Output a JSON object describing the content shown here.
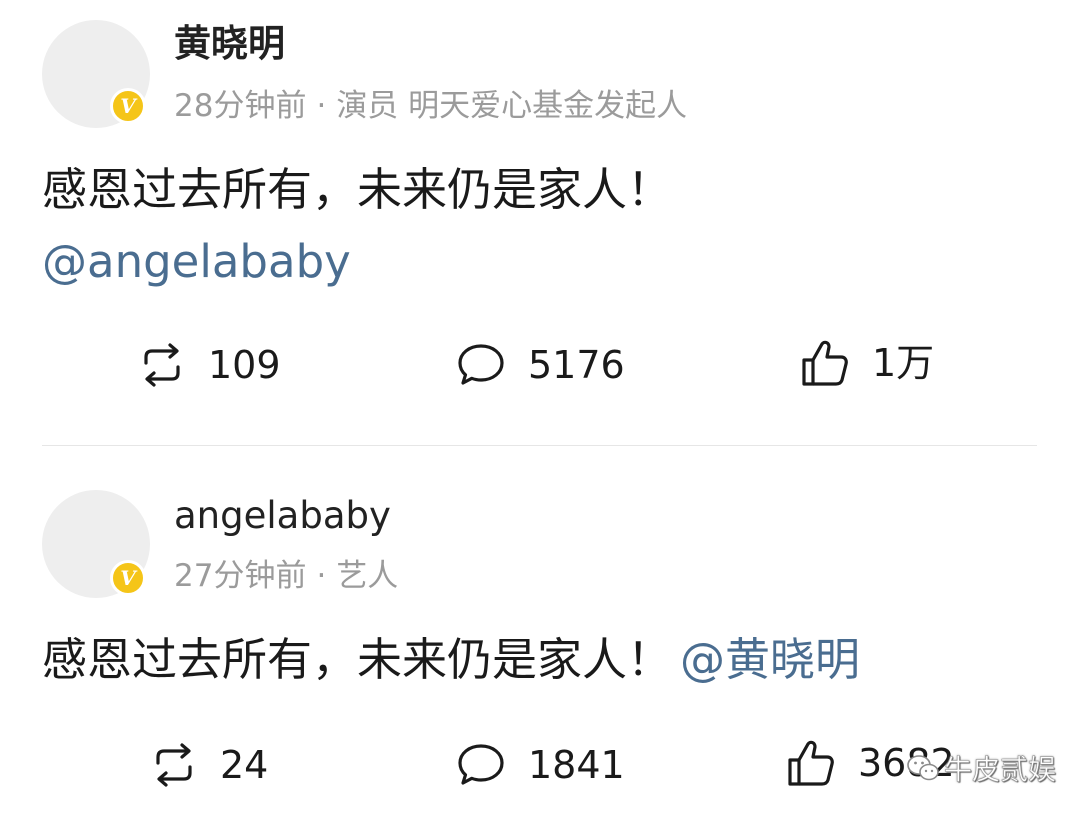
{
  "posts": [
    {
      "author": "黄晓明",
      "time": "28分钟前",
      "separator": "·",
      "role": "演员 明天爱心基金发起人",
      "badge": "V",
      "text": "感恩过去所有，未来仍是家人！",
      "mention": "@angelababy",
      "reposts": "109",
      "comments": "5176",
      "likes": "1万"
    },
    {
      "author": "angelababy",
      "time": "27分钟前",
      "separator": "·",
      "role": "艺人",
      "badge": "V",
      "text": "感恩过去所有，未来仍是家人！",
      "mention": "@黄晓明",
      "reposts": "24",
      "comments": "1841",
      "likes": "3682"
    }
  ],
  "watermark": {
    "text": "牛皮贰娱",
    "icon": "wechat-icon"
  },
  "colors": {
    "mention": "#4a6d90",
    "meta": "#9b9b9b",
    "badge": "#f5c518"
  }
}
